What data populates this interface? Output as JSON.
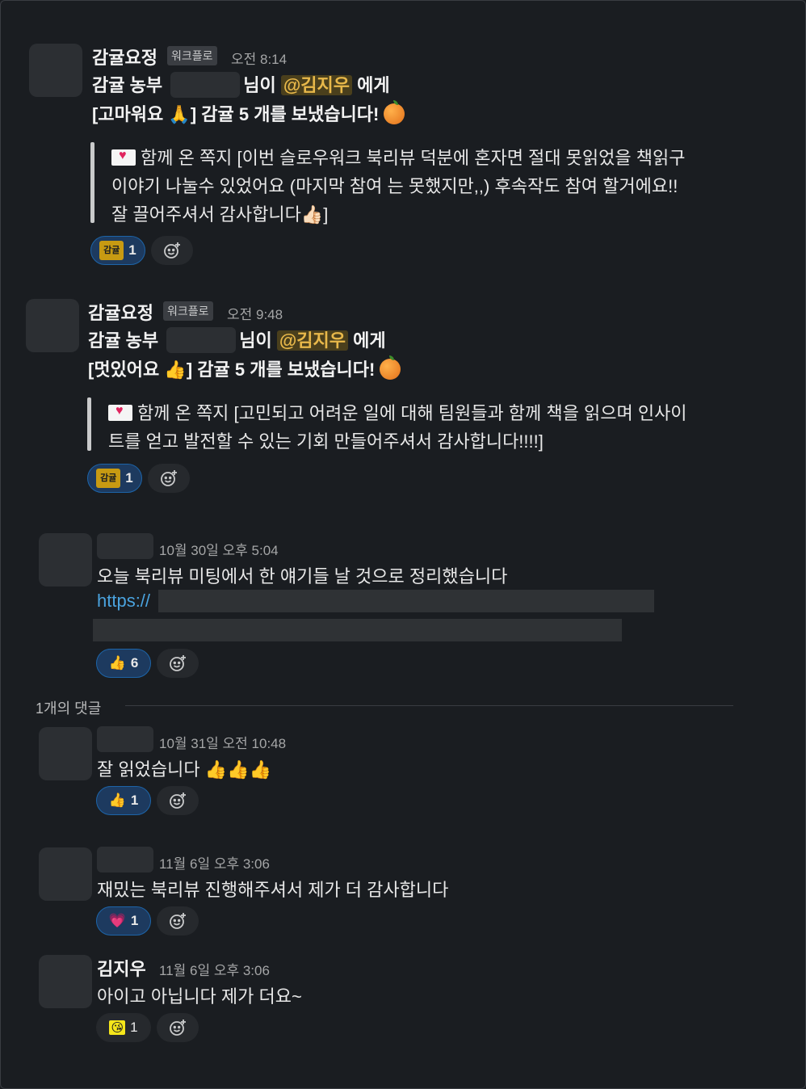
{
  "messages": [
    {
      "sender": "감귤요정",
      "badge": "워크플로",
      "time": "오전 8:14",
      "line1_prefix": "감귤 농부",
      "line1_suffix": "님이",
      "mention": "@김지우",
      "line1_end": "에게",
      "line2_open": "[고마워요",
      "line2_emoji": "🙏",
      "line2_rest": "] 감귤 5 개를 보냈습니다!",
      "quote_lines": [
        "함께 온 쪽지 [이번 슬로우워크 북리뷰 덕분에 혼자면 절대 못읽었을 책읽구",
        "이야기 나눌수 있었어요 (마지막 참여 는 못했지만,,) 후속작도 참여 할거에요!!",
        "잘 끌어주셔서 감사합니다👍🏻]"
      ],
      "reaction_emoji": "감귤",
      "reaction_count": "1"
    },
    {
      "sender": "감귤요정",
      "badge": "워크플로",
      "time": "오전 9:48",
      "line1_prefix": "감귤 농부",
      "line1_suffix": "님이",
      "mention": "@김지우",
      "line1_end": "에게",
      "line2_open": "[멋있어요",
      "line2_emoji": "👍",
      "line2_rest": "] 감귤 5 개를 보냈습니다!",
      "quote_lines": [
        "함께 온 쪽지 [고민되고 어려운 일에 대해 팀원들과 함께 책을 읽으며 인사이",
        "트를 얻고 발전할 수 있는 기회 만들어주셔서 감사합니다!!!!]"
      ],
      "reaction_emoji": "감귤",
      "reaction_count": "1"
    },
    {
      "time": "10월 30일 오후 5:04",
      "text": "오늘 북리뷰 미팅에서 한 얘기들 날 것으로 정리했습니다",
      "link": "https://",
      "reaction_emoji": "👍",
      "reaction_count": "6"
    }
  ],
  "thread": {
    "replies_label": "1개의 댓글"
  },
  "replies": [
    {
      "time": "10월 31일 오전 10:48",
      "text": "잘 읽었습니다 👍👍👍",
      "reaction_emoji": "👍",
      "reaction_count": "1"
    },
    {
      "time": "11월 6일 오후 3:06",
      "text": "재밌는 북리뷰 진행해주셔서 제가 더 감사합니다",
      "reaction_emoji": "💗",
      "reaction_count": "1"
    },
    {
      "sender": "김지우",
      "time": "11월 6일 오후 3:06",
      "text": "아이고 아닙니다 제가 더요~",
      "reaction_emoji": "😘",
      "reaction_count": "1"
    }
  ],
  "icons": {
    "add_reaction": "add-reaction-icon",
    "orange": "tangerine-icon",
    "envelope": "love-letter-icon"
  },
  "colors": {
    "background": "#1a1d21",
    "mention_text": "#e8b84a",
    "mention_bg": "#4a3f1c",
    "reaction_active_bg": "#1d3a5f",
    "reaction_active_border": "#1d64a8",
    "link": "#4aa3df"
  }
}
